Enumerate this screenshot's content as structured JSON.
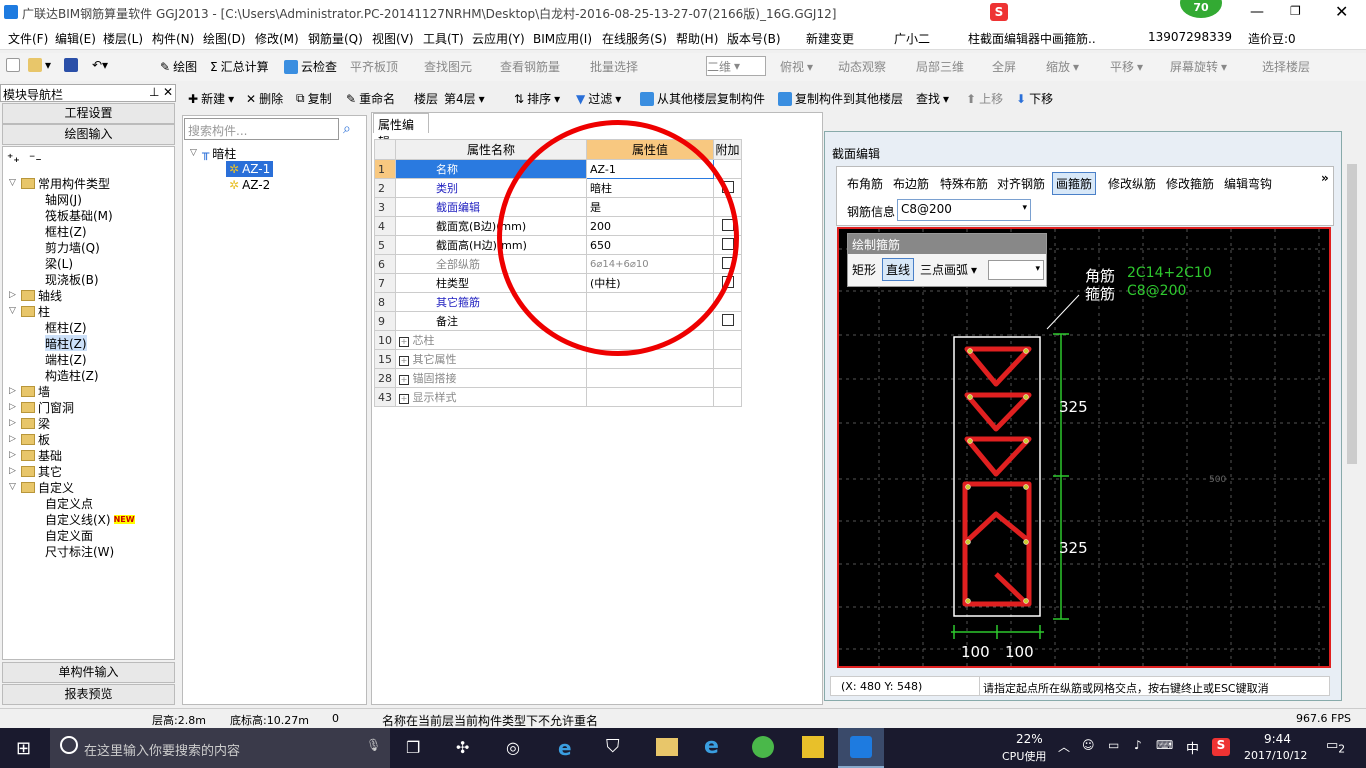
{
  "title": "广联达BIM钢筋算量软件 GGJ2013 - [C:\\Users\\Administrator.PC-20141127NRHM\\Desktop\\白龙村-2016-08-25-13-27-07(2166版)_16G.GGJ12]",
  "badge": "70",
  "menu": [
    "文件(F)",
    "编辑(E)",
    "楼层(L)",
    "构件(N)",
    "绘图(D)",
    "修改(M)",
    "钢筋量(Q)",
    "视图(V)",
    "工具(T)",
    "云应用(Y)",
    "BIM应用(I)",
    "在线服务(S)",
    "帮助(H)",
    "版本号(B)",
    "新建变更",
    "广小二",
    "柱截面编辑器中画箍筋..",
    "13907298339",
    "造价豆:0"
  ],
  "toolbar1": [
    "绘图",
    "汇总计算",
    "云检查",
    "平齐板顶",
    "查找图元",
    "查看钢筋量",
    "批量选择",
    "二维",
    "俯视",
    "动态观察",
    "局部三维",
    "全屏",
    "缩放",
    "平移",
    "屏幕旋转",
    "选择楼层"
  ],
  "toolbar2": [
    "新建",
    "删除",
    "复制",
    "重命名",
    "楼层",
    "第4层",
    "排序",
    "过滤",
    "从其他楼层复制构件",
    "复制构件到其他楼层",
    "查找",
    "上移",
    "下移"
  ],
  "nav": {
    "title": "模块导航栏",
    "btn1": "工程设置",
    "btn2": "绘图输入",
    "btn3": "单构件输入",
    "btn4": "报表预览"
  },
  "tree": [
    "常用构件类型",
    "轴网(J)",
    "筏板基础(M)",
    "框柱(Z)",
    "剪力墙(Q)",
    "梁(L)",
    "现浇板(B)",
    "轴线",
    "柱",
    "框柱(Z)",
    "暗柱(Z)",
    "端柱(Z)",
    "构造柱(Z)",
    "墙",
    "门窗洞",
    "梁",
    "板",
    "基础",
    "其它",
    "自定义",
    "自定义点",
    "自定义线(X)",
    "自定义面",
    "尺寸标注(W)"
  ],
  "newtag": "NEW",
  "search_ph": "搜索构件...",
  "comp": {
    "root": "暗柱",
    "items": [
      "AZ-1",
      "AZ-2"
    ]
  },
  "prop": {
    "tab": "属性编辑",
    "h_name": "属性名称",
    "h_val": "属性值",
    "h_add": "附加",
    "rows": [
      [
        "1",
        "名称",
        "AZ-1"
      ],
      [
        "2",
        "类别",
        "暗柱"
      ],
      [
        "3",
        "截面编辑",
        "是"
      ],
      [
        "4",
        "截面宽(B边)(mm)",
        "200"
      ],
      [
        "5",
        "截面高(H边)(mm)",
        "650"
      ],
      [
        "6",
        "全部纵筋",
        "6⌀14+6⌀10"
      ],
      [
        "7",
        "柱类型",
        "(中柱)"
      ],
      [
        "8",
        "其它箍筋",
        ""
      ],
      [
        "9",
        "备注",
        ""
      ],
      [
        "10",
        "芯柱",
        ""
      ],
      [
        "15",
        "其它属性",
        ""
      ],
      [
        "28",
        "锚固搭接",
        ""
      ],
      [
        "43",
        "显示样式",
        ""
      ]
    ]
  },
  "sec": {
    "title": "截面编辑",
    "tabs": [
      "布角筋",
      "布边筋",
      "特殊布筋",
      "对齐钢筋",
      "画箍筋",
      "修改纵筋",
      "修改箍筋",
      "编辑弯钩"
    ],
    "info_label": "钢筋信息",
    "info_val": "C8@200",
    "draw_title": "绘制箍筋",
    "draw_btns": [
      "矩形",
      "直线",
      "三点画弧"
    ],
    "lbl1": "角筋",
    "lbl2": "箍筋",
    "val1": "2C14+2C10",
    "val2": "C8@200",
    "dim1": "325",
    "dim2": "325",
    "dimb1": "100",
    "dimb2": "100",
    "grid": "500",
    "coord": "(X: 480 Y: 548)",
    "hint": "请指定起点所在纵筋或网格交点，按右键终止或ESC键取消"
  },
  "status": [
    "层高:2.8m",
    "底标高:10.27m",
    "0",
    "名称在当前层当前构件类型下不允许重名",
    "967.6 FPS"
  ],
  "task": {
    "search": "在这里输入你要搜索的内容",
    "cpu": "22%",
    "cpu_lbl": "CPU使用",
    "ime": "中",
    "time": "9:44",
    "date": "2017/10/12",
    "notif": "2"
  }
}
